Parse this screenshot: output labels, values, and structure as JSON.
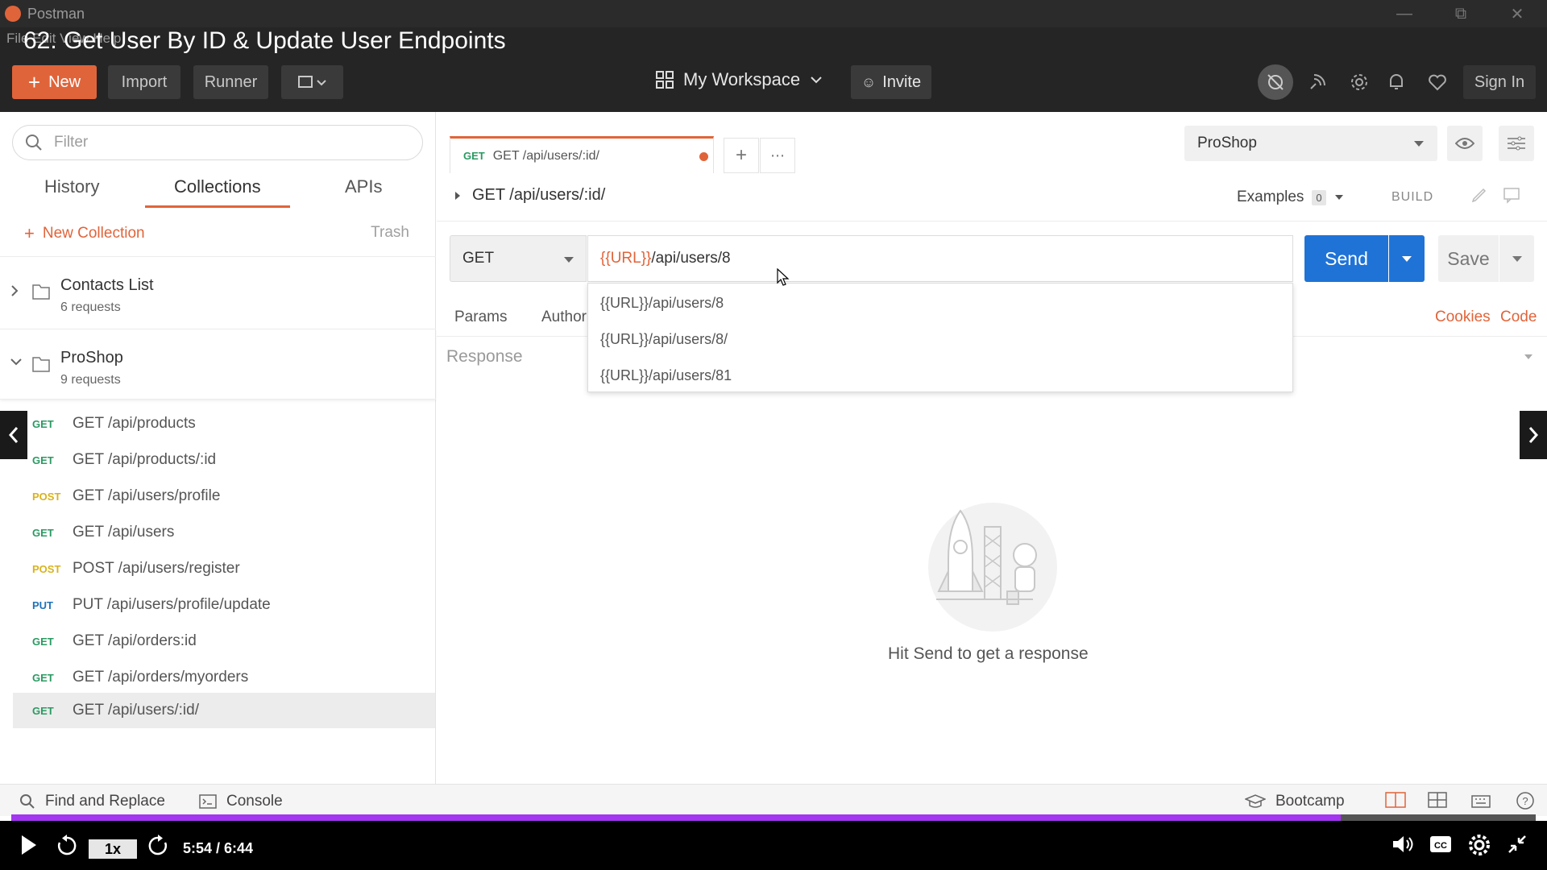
{
  "window": {
    "app_name": "Postman"
  },
  "overlay": {
    "video_title": "62. Get User By ID & Update User Endpoints",
    "menu_text": "File  Edit  View  Help"
  },
  "header": {
    "new_label": "New",
    "import_label": "Import",
    "runner_label": "Runner",
    "workspace_label": "My Workspace",
    "invite_label": "Invite",
    "signin_label": "Sign In"
  },
  "sidebar": {
    "filter_placeholder": "Filter",
    "tabs": {
      "history": "History",
      "collections": "Collections",
      "apis": "APIs"
    },
    "new_collection": "New Collection",
    "trash": "Trash",
    "collections": [
      {
        "name": "Contacts List",
        "count": "6 requests"
      },
      {
        "name": "ProShop",
        "count": "9 requests"
      }
    ],
    "requests": [
      {
        "method": "GET",
        "name": "GET /api/products"
      },
      {
        "method": "GET",
        "name": "GET /api/products/:id"
      },
      {
        "method": "POST",
        "name": "GET /api/users/profile"
      },
      {
        "method": "GET",
        "name": "GET /api/users"
      },
      {
        "method": "POST",
        "name": "POST /api/users/register"
      },
      {
        "method": "PUT",
        "name": "PUT /api/users/profile/update"
      },
      {
        "method": "GET",
        "name": "GET /api/orders:id"
      },
      {
        "method": "GET",
        "name": "GET /api/orders/myorders"
      },
      {
        "method": "GET",
        "name": "GET /api/users/:id/"
      }
    ]
  },
  "main": {
    "tab": {
      "method": "GET",
      "title": "GET /api/users/:id/"
    },
    "environment": "ProShop",
    "request_title": "GET /api/users/:id/",
    "examples_label": "Examples",
    "examples_count": "0",
    "build_label": "BUILD",
    "method": "GET",
    "url_var": "{{URL}}",
    "url_path": "/api/users/8",
    "send_label": "Send",
    "save_label": "Save",
    "subtabs": {
      "params": "Params",
      "auth": "Author"
    },
    "cookies_label": "Cookies",
    "code_label": "Code",
    "response_label": "Response",
    "autocomplete": [
      "{{URL}}/api/users/8",
      "{{URL}}/api/users/8/",
      "{{URL}}/api/users/81"
    ],
    "empty_hint": "Hit Send to get a response"
  },
  "statusbar": {
    "find_replace": "Find and Replace",
    "console": "Console",
    "bootcamp": "Bootcamp"
  },
  "video": {
    "speed": "1x",
    "time": "5:54 / 6:44",
    "progress_fraction": 0.872
  },
  "colors": {
    "accent": "#e0643a",
    "send_blue": "#1f73d6",
    "get": "#2b9a63",
    "post": "#d9b21c",
    "put": "#1f73b9",
    "progress": "#a435f0"
  }
}
